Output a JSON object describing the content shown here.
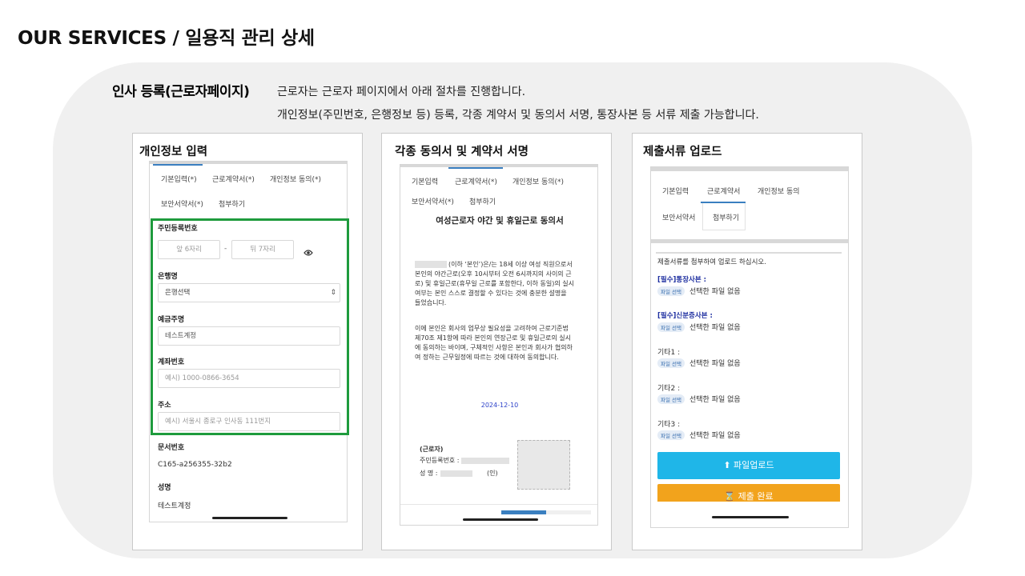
{
  "page": {
    "title": "OUR SERVICES / 일용직 관리 상세"
  },
  "intro": {
    "title": "인사 등록(근로자페이지)",
    "line1": "근로자는 근로자 페이지에서 아래 절차를 진행합니다.",
    "line2": "개인정보(주민번호, 은행정보 등) 등록, 각종 계약서 및 동의서 서명, 통장사본 등 서류 제출 가능합니다."
  },
  "card1": {
    "title": "개인정보 입력",
    "tabs": [
      "기본입력(*)",
      "근로계약서(*)",
      "개인정보 동의(*)",
      "보안서약서(*)",
      "첨부하기"
    ],
    "rrn_label": "주민등록번호",
    "rrn_front_placeholder": "앞 6자리",
    "rrn_dash": "-",
    "rrn_back_placeholder": "뒤 7자리",
    "bank_label": "은행명",
    "bank_value": "은행선택",
    "holder_label": "예금주명",
    "holder_value": "테스트계정",
    "account_label": "계좌번호",
    "account_placeholder": "예시) 1000-0866-3654",
    "address_label": "주소",
    "address_placeholder": "예시) 서울시 종로구 인사동 111번지",
    "doc_no_label": "문서번호",
    "doc_no_value": "C165-a256355-32b2",
    "name_label": "성명",
    "name_value": "테스트계정"
  },
  "card2": {
    "title": "각종 동의서 및 계약서 서명",
    "tabs": [
      "기본입력",
      "근로계약서(*)",
      "개인정보 동의(*)",
      "보안서약서(*)",
      "첨부하기"
    ],
    "doc_title": "여성근로자 야간 및 휴일근로 동의서",
    "para1": [
      "(이하 ‘본인’)은/는 18세 이상 여성 직원으로서",
      "본인의 야간근로(오후 10시부터 오전 6시까지의 사이의 근",
      "로) 및 휴일근로(휴무일 근로를 포함한다, 이하 동일)의 실시",
      "여부는 본인 스스로 결정할 수 있다는 것에 충분한 설명을",
      "들었습니다."
    ],
    "para2": [
      "이에 본인은 회사의 업무상 필요성을 고려하여 근로기준법",
      "제70조 제1항에 따라 본인의 연장근로 및 휴일근로의 실시",
      "에 동의하는 바이며, 구체적인 사항은 본인과 회사가 협의하",
      "여 정하는 근무일정에 따르는 것에 대하여 동의합니다."
    ],
    "date": "2024-12-10",
    "worker_label": "(근로자)",
    "rrn_label": "주민등록번호 :",
    "name_label": "성 명 :",
    "seal": "(인)"
  },
  "card3": {
    "title": "제출서류 업로드",
    "tabs": [
      "기본입력",
      "근로계약서",
      "개인정보 동의",
      "보안서약서",
      "첨부하기"
    ],
    "instruction": "제출서류를 첨부하여 업로드 하십시오.",
    "files": [
      {
        "label": "[필수]통장사본 :",
        "button": "파일 선택",
        "status": "선택한 파일 없음"
      },
      {
        "label": "[필수]신분증사본 :",
        "button": "파일 선택",
        "status": "선택한 파일 없음"
      },
      {
        "label": "기타1 :",
        "button": "파일 선택",
        "status": "선택한 파일 없음"
      },
      {
        "label": "기타2 :",
        "button": "파일 선택",
        "status": "선택한 파일 없음"
      },
      {
        "label": "기타3 :",
        "button": "파일 선택",
        "status": "선택한 파일 없음"
      }
    ],
    "upload_button": "파일업로드",
    "submit_button": "제출 완료"
  }
}
